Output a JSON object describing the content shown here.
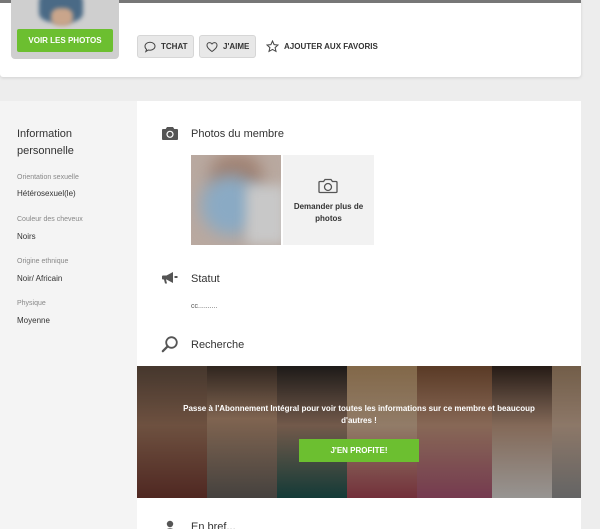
{
  "header": {
    "photos_button": "VOIR LES PHOTOS",
    "chat_button": "TCHAT",
    "like_button": "J'AIME",
    "favorite_button": "AJOUTER AUX FAVORIS"
  },
  "sidebar": {
    "title": "Information personnelle",
    "fields": [
      {
        "label": "Orientation sexuelle",
        "value": "Hétérosexuel(le)"
      },
      {
        "label": "Couleur des cheveux",
        "value": "Noirs"
      },
      {
        "label": "Origine ethnique",
        "value": "Noir/ Africain"
      },
      {
        "label": "Physique",
        "value": "Moyenne"
      }
    ]
  },
  "sections": {
    "photos": {
      "title": "Photos du membre",
      "request_label": "Demander plus de photos",
      "icon": "camera-icon"
    },
    "statut": {
      "title": "Statut",
      "value": "cc..........",
      "icon": "megaphone-icon"
    },
    "recherche": {
      "title": "Recherche",
      "icon": "search-icon"
    },
    "next": {
      "title": "En bref...",
      "icon": "person-pin-icon"
    }
  },
  "banner": {
    "text": "Passe à l'Abonnement Intégral pour voir toutes les informations sur ce membre et beaucoup d'autres !",
    "cta": "J'EN PROFITE!"
  },
  "colors": {
    "accent": "#6cbf30",
    "page_bg": "#ededed",
    "sidebar_bg": "#f4f4f4"
  }
}
